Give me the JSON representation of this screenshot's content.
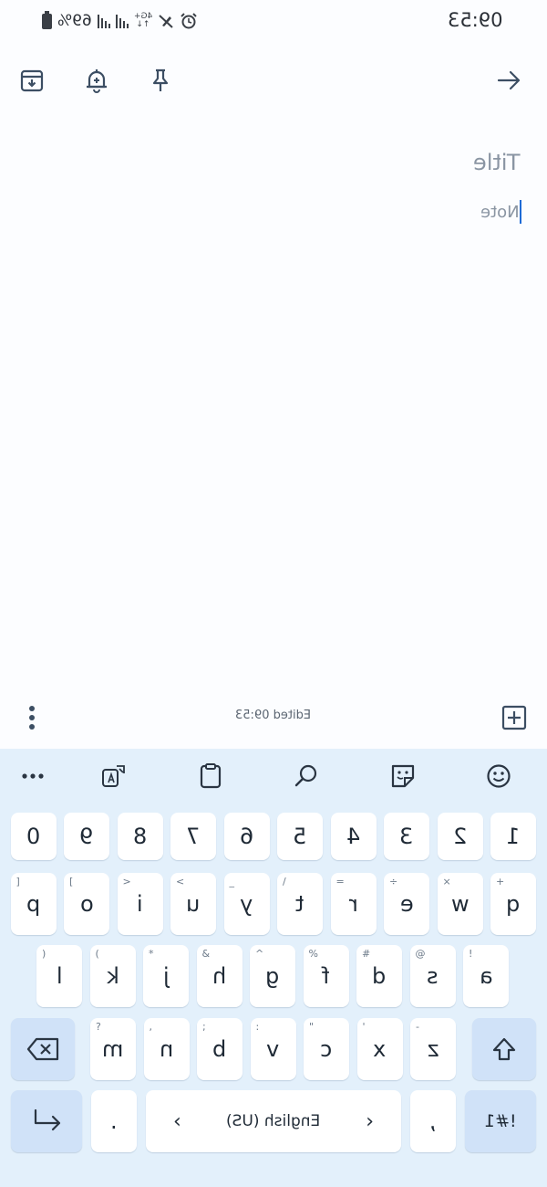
{
  "status_bar": {
    "time": "09:53",
    "battery": "69%",
    "network": "4G+",
    "icons": [
      "battery-icon",
      "signal-icon",
      "signal-icon",
      "data-arrows-icon",
      "mute-icon",
      "alarm-icon"
    ]
  },
  "toolbar": {
    "icons": [
      "archive-icon",
      "reminder-bell-icon",
      "pin-icon",
      "back-arrow-icon"
    ]
  },
  "note": {
    "title_placeholder": "Title",
    "body_placeholder": "Note"
  },
  "bottom_bar": {
    "edited_text": "Edited 09:53",
    "icons": [
      "more-vert-icon",
      "add-box-icon"
    ]
  },
  "keyboard": {
    "toolbar_icons": [
      "more-horiz-icon",
      "translate-icon",
      "clipboard-icon",
      "search-icon",
      "sticker-icon",
      "emoji-icon"
    ],
    "number_row": [
      "1",
      "2",
      "3",
      "4",
      "5",
      "6",
      "7",
      "8",
      "9",
      "0"
    ],
    "row1": [
      {
        "key": "q",
        "hint": "+"
      },
      {
        "key": "w",
        "hint": "×"
      },
      {
        "key": "e",
        "hint": "÷"
      },
      {
        "key": "r",
        "hint": "="
      },
      {
        "key": "t",
        "hint": "/"
      },
      {
        "key": "y",
        "hint": "_"
      },
      {
        "key": "u",
        "hint": "<"
      },
      {
        "key": "i",
        "hint": ">"
      },
      {
        "key": "o",
        "hint": "["
      },
      {
        "key": "p",
        "hint": "]"
      }
    ],
    "row2": [
      {
        "key": "a",
        "hint": "!"
      },
      {
        "key": "s",
        "hint": "@"
      },
      {
        "key": "d",
        "hint": "#"
      },
      {
        "key": "f",
        "hint": "%"
      },
      {
        "key": "g",
        "hint": "^"
      },
      {
        "key": "h",
        "hint": "&"
      },
      {
        "key": "j",
        "hint": "*"
      },
      {
        "key": "k",
        "hint": "("
      },
      {
        "key": "l",
        "hint": ")"
      }
    ],
    "row3": [
      {
        "key": "z",
        "hint": "-"
      },
      {
        "key": "x",
        "hint": "'"
      },
      {
        "key": "c",
        "hint": "\""
      },
      {
        "key": "v",
        "hint": ":"
      },
      {
        "key": "b",
        "hint": ";"
      },
      {
        "key": "n",
        "hint": ","
      },
      {
        "key": "m",
        "hint": "?"
      }
    ],
    "symbols_label": "!#1",
    "comma": ",",
    "space_label": "English (US)",
    "period": ".",
    "shift_icon": "shift-icon",
    "backspace_icon": "backspace-icon",
    "enter_icon": "enter-icon"
  }
}
